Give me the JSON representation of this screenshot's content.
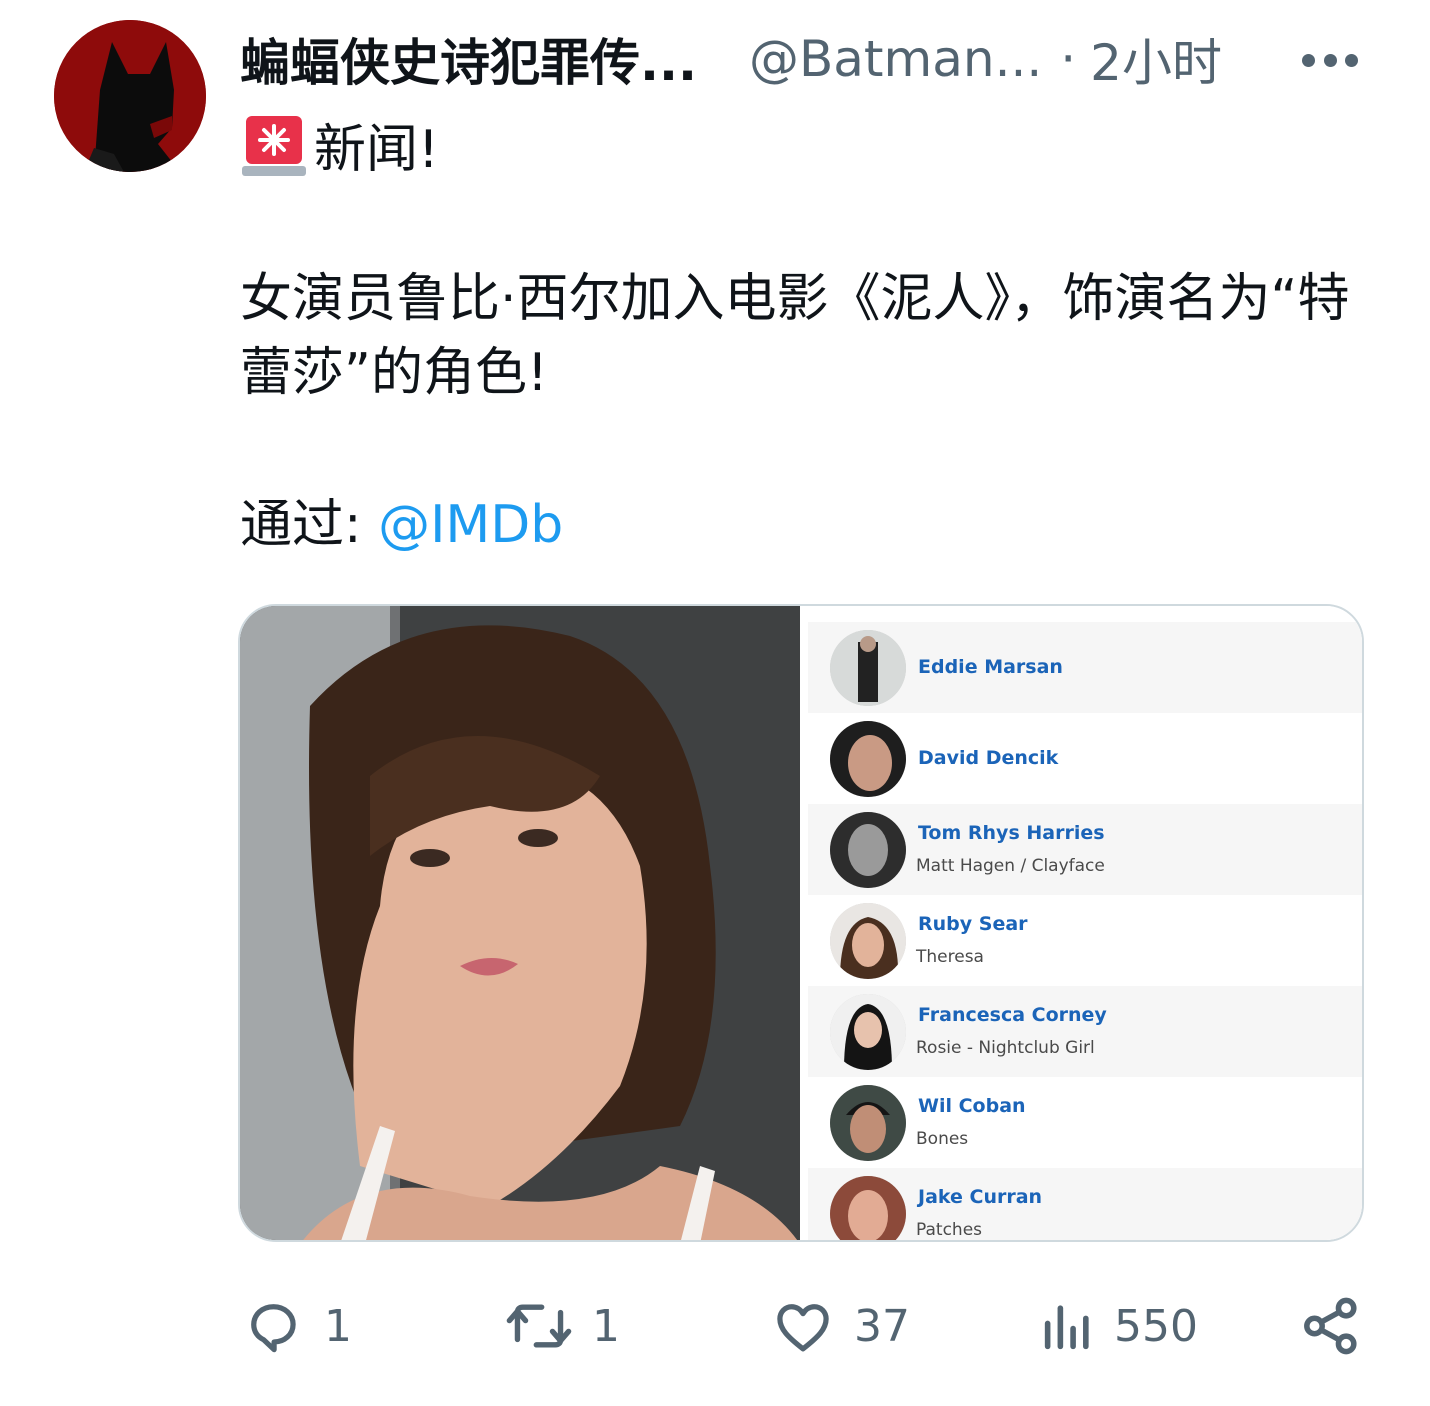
{
  "tweet": {
    "display_name": "蝙蝠侠史诗犯罪传...",
    "handle": "@Batman...",
    "separator": "·",
    "time": "2小时",
    "headline": "新闻!",
    "body": "女演员鲁比·西尔加入电影《泥人》，饰演名为“特蕾莎”的角色!",
    "via_label": "通过:",
    "via_mention": "@IMDb"
  },
  "cast": [
    {
      "name": "Eddie Marsan",
      "role": ""
    },
    {
      "name": "David Dencik",
      "role": ""
    },
    {
      "name": "Tom Rhys Harries",
      "role": "Matt Hagen / Clayface"
    },
    {
      "name": "Ruby Sear",
      "role": "Theresa"
    },
    {
      "name": "Francesca Corney",
      "role": "Rosie - Nightclub Girl"
    },
    {
      "name": "Wil Coban",
      "role": "Bones"
    },
    {
      "name": "Jake Curran",
      "role": "Patches"
    }
  ],
  "actions": {
    "reply_count": "1",
    "retweet_count": "1",
    "like_count": "37",
    "views_count": "550"
  },
  "icons": [
    "more-icon",
    "siren-emoji-icon",
    "reply-icon",
    "retweet-icon",
    "like-icon",
    "views-icon",
    "share-icon"
  ],
  "colors": {
    "link": "#1d9bf0",
    "muted": "#536471",
    "avatar_bg": "#8e0b0b",
    "cast_name": "#1b64b8"
  }
}
